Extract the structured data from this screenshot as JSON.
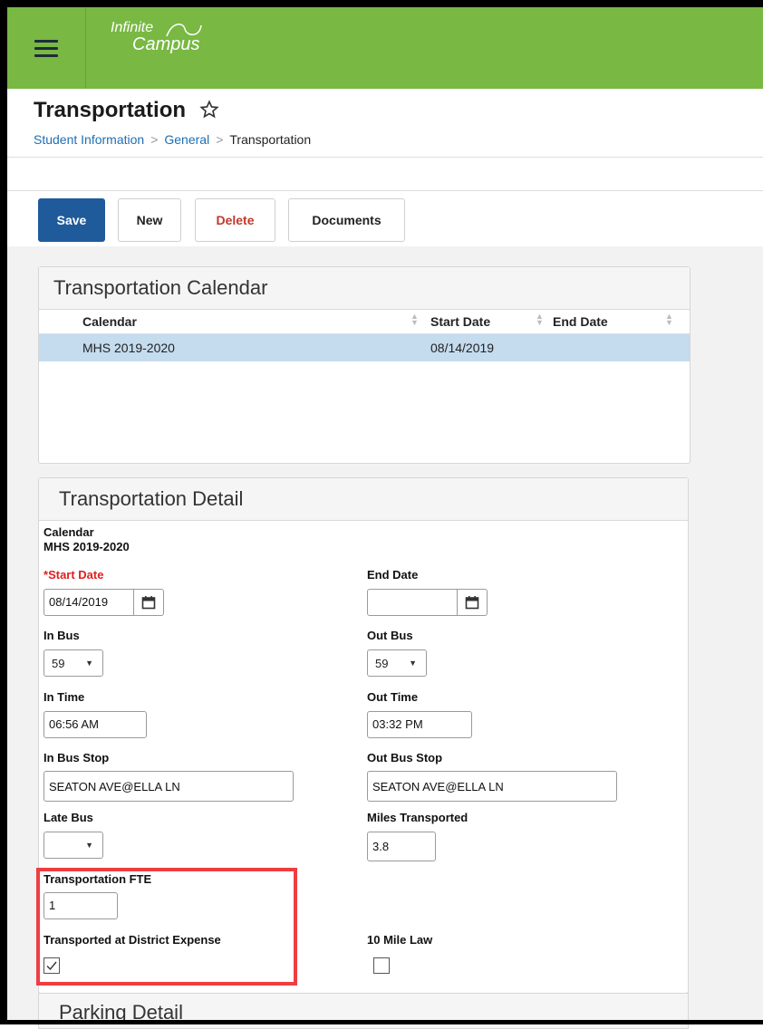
{
  "app": {
    "logo_line1": "Infinite",
    "logo_line2": "Campus"
  },
  "header": {
    "title": "Transportation",
    "breadcrumb": [
      "Student Information",
      "General",
      "Transportation"
    ]
  },
  "toolbar": {
    "save_label": "Save",
    "new_label": "New",
    "delete_label": "Delete",
    "documents_label": "Documents"
  },
  "calendar_panel": {
    "title": "Transportation Calendar",
    "columns": [
      "Calendar",
      "Start Date",
      "End Date"
    ],
    "rows": [
      {
        "calendar": "MHS 2019-2020",
        "start_date": "08/14/2019",
        "end_date": ""
      }
    ]
  },
  "detail": {
    "title": "Transportation Detail",
    "calendar_label": "Calendar",
    "calendar_value": "MHS 2019-2020",
    "start_date_label": "Start Date",
    "start_date_value": "08/14/2019",
    "end_date_label": "End Date",
    "end_date_value": "",
    "in_bus_label": "In Bus",
    "in_bus_value": "59",
    "out_bus_label": "Out Bus",
    "out_bus_value": "59",
    "in_time_label": "In Time",
    "in_time_value": "06:56 AM",
    "out_time_label": "Out Time",
    "out_time_value": "03:32 PM",
    "in_bus_stop_label": "In Bus Stop",
    "in_bus_stop_value": "SEATON AVE@ELLA LN",
    "out_bus_stop_label": "Out Bus Stop",
    "out_bus_stop_value": "SEATON AVE@ELLA LN",
    "late_bus_label": "Late Bus",
    "late_bus_value": "",
    "miles_label": "Miles Transported",
    "miles_value": "3.8",
    "fte_label": "Transportation FTE",
    "fte_value": "1",
    "district_expense_label": "Transported at District Expense",
    "district_expense_checked": true,
    "mile_law_label": "10 Mile Law",
    "mile_law_checked": false
  },
  "parking": {
    "title": "Parking Detail"
  },
  "colors": {
    "topbar": "#78b843",
    "save_button": "#1f5b9b",
    "link": "#1f6fb2",
    "delete_text": "#c0392b",
    "selected_row": "#c5dbee",
    "highlight": "#ef3e42",
    "required": "#e02020"
  },
  "icons": [
    "menu-icon",
    "star-icon",
    "calendar-icon",
    "chevron-right-icon",
    "dropdown-arrow-icon",
    "sort-icon",
    "check-icon"
  ]
}
